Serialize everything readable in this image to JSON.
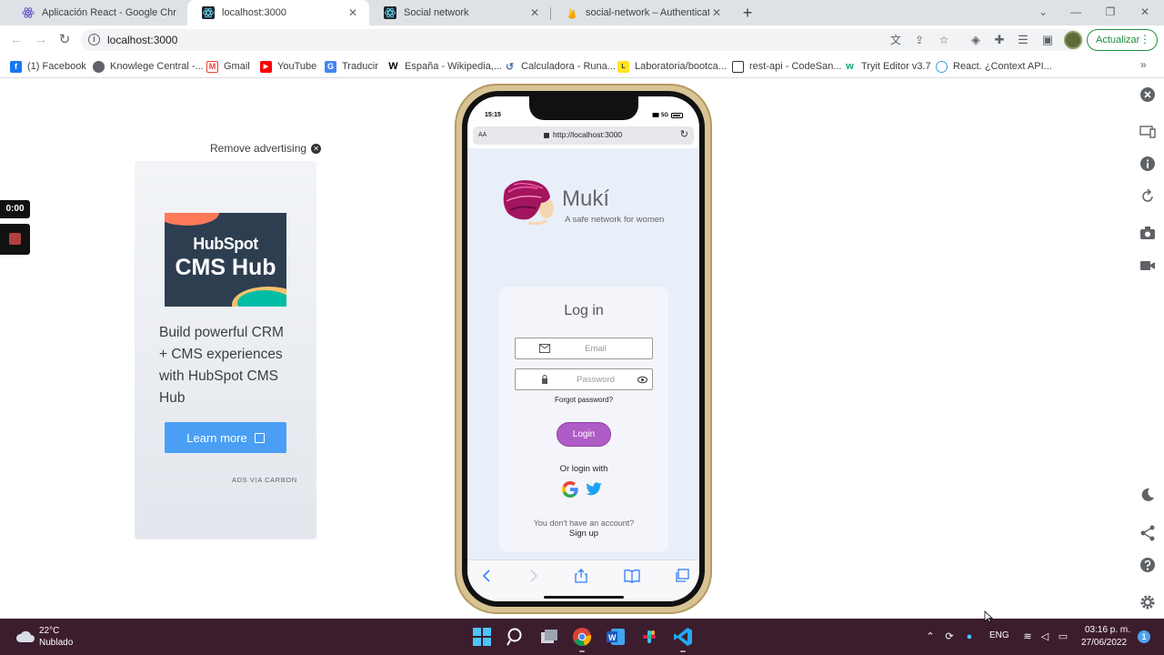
{
  "browser": {
    "tabs": [
      {
        "title": "Aplicación React - Google Chrom",
        "active": false
      },
      {
        "title": "localhost:3000",
        "active": true
      },
      {
        "title": "Social network",
        "active": false
      },
      {
        "title": "social-network – Authentication -",
        "active": false
      }
    ],
    "url": "localhost:3000",
    "update_label": "Actualizar",
    "bookmarks": [
      "(1) Facebook",
      "Knowlege Central -...",
      "Gmail",
      "YouTube",
      "Traducir",
      "España - Wikipedia,...",
      "Calculadora - Runa...",
      "Laboratoria/bootca...",
      "rest-api - CodeSan...",
      "Tryit Editor v3.7",
      "React. ¿Context API..."
    ]
  },
  "ad": {
    "remove_label": "Remove advertising",
    "brand": "HubSpot",
    "product": "CMS Hub",
    "text": "Build powerful CRM + CMS experiences with HubSpot CMS Hub",
    "button": "Learn more",
    "via": "ADS VIA CARBON"
  },
  "recorder": {
    "timer": "0:00"
  },
  "phone": {
    "time": "15:15",
    "network": "5G",
    "aa": "AA",
    "url": "http://localhost:3000",
    "app": {
      "name": "Mukí",
      "tagline": "A safe network for women",
      "login_title": "Log in",
      "email_placeholder": "Email",
      "password_placeholder": "Password",
      "forgot": "Forgot password?",
      "login_button": "Login",
      "or_login_with": "Or login with",
      "no_account": "You don't have an account?",
      "signup": "Sign up"
    }
  },
  "taskbar": {
    "temperature": "22°C",
    "weather": "Nublado",
    "language": "ENG",
    "time": "03:16 p. m.",
    "date": "27/06/2022",
    "notifications": "1"
  },
  "colors": {
    "accent_login": "#b05cc6",
    "learn_more": "#4a9ff5",
    "taskbar": "#3c1d2e",
    "app_bg": "#e9eff9"
  }
}
